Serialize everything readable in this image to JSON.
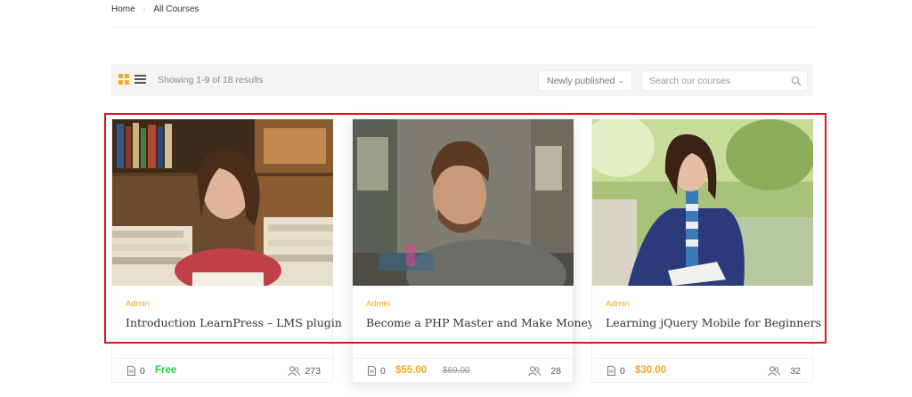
{
  "breadcrumb": {
    "home": "Home",
    "separator": "›",
    "current": "All Courses"
  },
  "toolbar": {
    "results_text": "Showing 1-9 of 18 results",
    "sort_value": "Newly published",
    "search_placeholder": "Search our courses"
  },
  "colors": {
    "accent": "#f8a824",
    "free": "#2ecc48",
    "highlight": "#e0151c"
  },
  "courses": [
    {
      "author": "Admin",
      "title": "Introduction LearnPress – LMS plugin",
      "lessons": "0",
      "price": "Free",
      "old_price": "",
      "students": "273"
    },
    {
      "author": "Admin",
      "title": "Become a PHP Master and Make Money",
      "lessons": "0",
      "price": "$55.00",
      "old_price": "$69.00",
      "students": "28"
    },
    {
      "author": "Admin",
      "title": "Learning jQuery Mobile for Beginners",
      "lessons": "0",
      "price": "$30.00",
      "old_price": "",
      "students": "32"
    }
  ]
}
